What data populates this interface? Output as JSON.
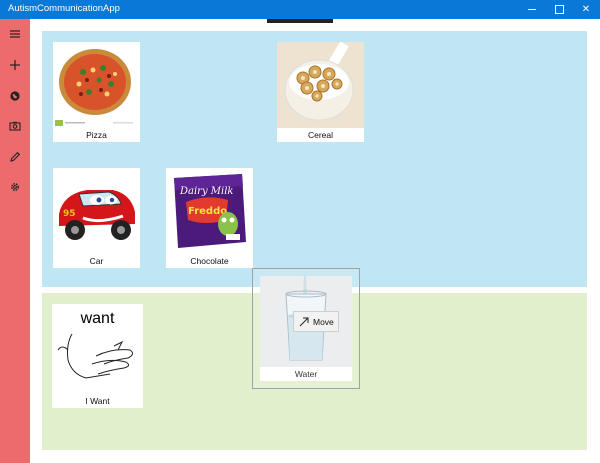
{
  "window": {
    "title": "AutismCommunicationApp",
    "minimize_icon": "minimize-icon",
    "maximize_icon": "maximize-icon",
    "close_glyph": "✕"
  },
  "sidebar": {
    "background": "#ee6b6d",
    "items": [
      {
        "name": "menu",
        "icon": "hamburger-icon"
      },
      {
        "name": "add",
        "icon": "plus-icon"
      },
      {
        "name": "web",
        "icon": "globe-icon"
      },
      {
        "name": "camera",
        "icon": "camera-icon"
      },
      {
        "name": "edit",
        "icon": "pencil-icon"
      },
      {
        "name": "settings",
        "icon": "gear-icon"
      }
    ]
  },
  "top_panel": {
    "color": "#bfe6f2",
    "cards": [
      {
        "label": "Pizza",
        "image": "pizza"
      },
      {
        "label": "Cereal",
        "image": "cereal-bowl"
      },
      {
        "label": "Car",
        "image": "red-cartoon-car"
      },
      {
        "label": "Chocolate",
        "image": "chocolate-bar"
      }
    ]
  },
  "bottom_panel": {
    "color": "#e1efcc",
    "cards": [
      {
        "label": "I Want",
        "image": "sign-want",
        "image_text": "want"
      },
      {
        "label": "Water",
        "image": "glass-of-water"
      }
    ]
  },
  "drag": {
    "tooltip_label": "Move",
    "tooltip_icon": "move-arrow-icon"
  }
}
